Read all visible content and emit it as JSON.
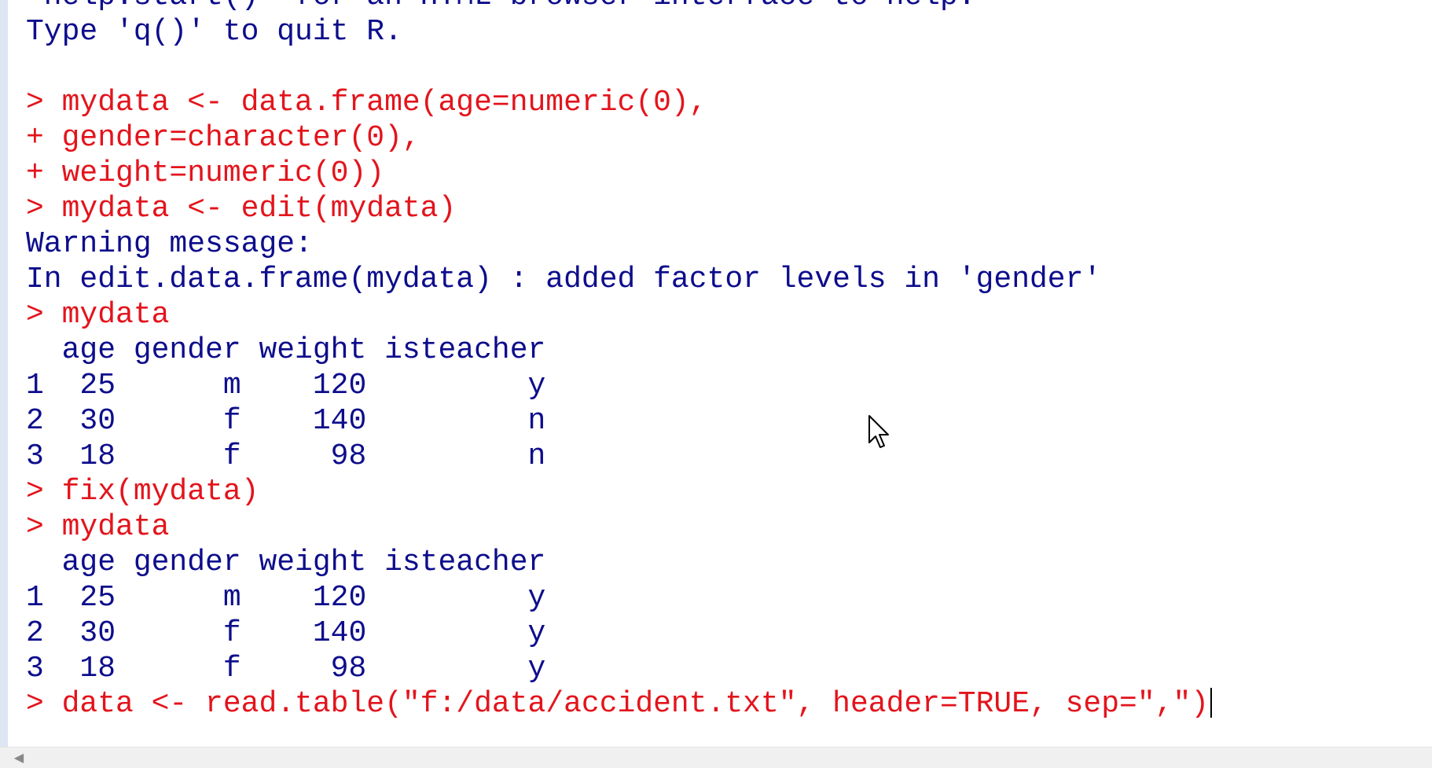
{
  "console": {
    "lines": [
      {
        "type": "out",
        "text": "\"help.start()\" for an HTML browser interface to help."
      },
      {
        "type": "out",
        "text": "Type 'q()' to quit R."
      },
      {
        "type": "out",
        "text": ""
      },
      {
        "type": "cmd",
        "text": "> mydata <- data.frame(age=numeric(0),"
      },
      {
        "type": "cmd",
        "text": "+ gender=character(0),"
      },
      {
        "type": "cmd",
        "text": "+ weight=numeric(0))"
      },
      {
        "type": "cmd",
        "text": "> mydata <- edit(mydata)"
      },
      {
        "type": "out",
        "text": "Warning message:"
      },
      {
        "type": "out",
        "text": "In edit.data.frame(mydata) : added factor levels in 'gender'"
      },
      {
        "type": "cmd",
        "text": "> mydata"
      },
      {
        "type": "out",
        "text": "  age gender weight isteacher"
      },
      {
        "type": "out",
        "text": "1  25      m    120         y"
      },
      {
        "type": "out",
        "text": "2  30      f    140         n"
      },
      {
        "type": "out",
        "text": "3  18      f     98         n"
      },
      {
        "type": "cmd",
        "text": "> fix(mydata)"
      },
      {
        "type": "cmd",
        "text": "> mydata"
      },
      {
        "type": "out",
        "text": "  age gender weight isteacher"
      },
      {
        "type": "out",
        "text": "1  25      m    120         y"
      },
      {
        "type": "out",
        "text": "2  30      f    140         y"
      },
      {
        "type": "out",
        "text": "3  18      f     98         y"
      }
    ],
    "current_input": "> data <- read.table(\"f:/data/accident.txt\", header=TRUE, sep=\",\")"
  },
  "icons": {
    "scroll_left": "chevron-left-icon",
    "mouse_pointer": "mouse-pointer-icon"
  },
  "colors": {
    "output_text": "#0d0d8c",
    "command_text": "#e3141c",
    "background": "#ffffff"
  }
}
